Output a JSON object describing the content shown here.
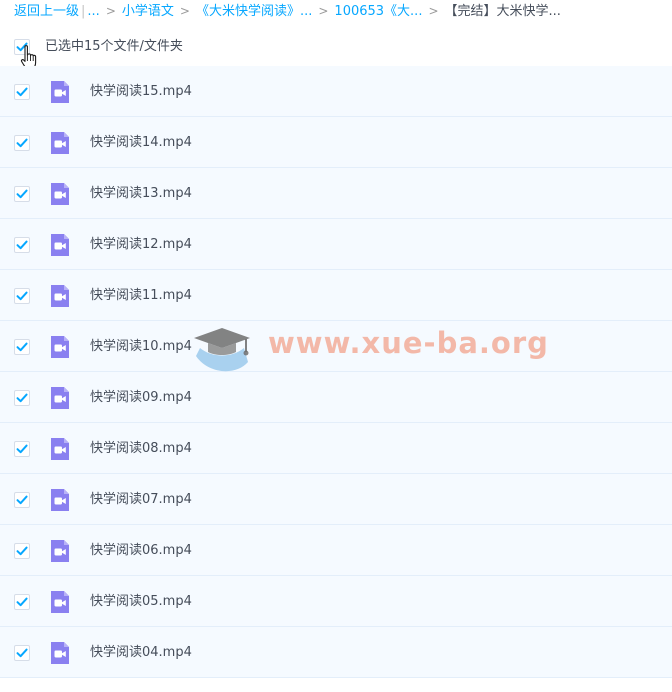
{
  "breadcrumb": {
    "back_label": "返回上一级",
    "ellipsis": "...",
    "items": [
      "小学语文",
      "《大米快学阅读》...",
      "100653《大...",
      "【完结】大米快学..."
    ]
  },
  "selection": {
    "label": "已选中15个文件/文件夹"
  },
  "files": [
    {
      "name": "快学阅读15.mp4"
    },
    {
      "name": "快学阅读14.mp4"
    },
    {
      "name": "快学阅读13.mp4"
    },
    {
      "name": "快学阅读12.mp4"
    },
    {
      "name": "快学阅读11.mp4"
    },
    {
      "name": "快学阅读10.mp4"
    },
    {
      "name": "快学阅读09.mp4"
    },
    {
      "name": "快学阅读08.mp4"
    },
    {
      "name": "快学阅读07.mp4"
    },
    {
      "name": "快学阅读06.mp4"
    },
    {
      "name": "快学阅读05.mp4"
    },
    {
      "name": "快学阅读04.mp4"
    }
  ],
  "watermark": {
    "text": "www.xue-ba.org"
  },
  "colors": {
    "accent": "#06a7ff",
    "check": "#06a7ff",
    "video_icon": "#8a80f0",
    "row_bg": "#f5faff",
    "text": "#454d5a"
  }
}
